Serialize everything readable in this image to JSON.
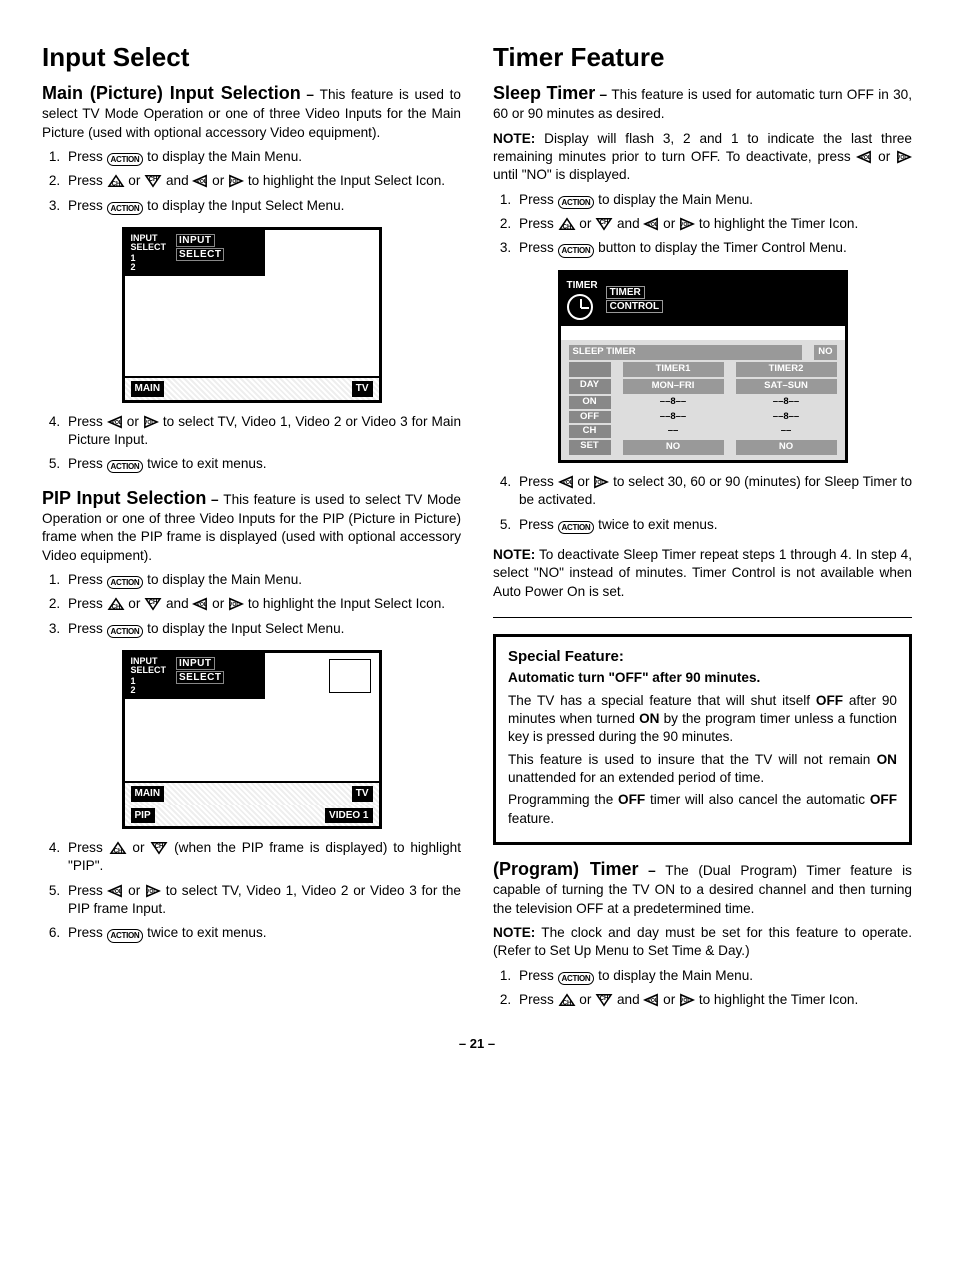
{
  "page_number": "– 21 –",
  "icons": {
    "action": "ACTION"
  },
  "left": {
    "h1": "Input Select",
    "main_sel": {
      "title": "Main (Picture) Input Selection",
      "dash": " – ",
      "lead": "This feature is used to select TV Mode Operation or one of three Video Inputs for the Main Picture (used with optional accessory Video equipment).",
      "s1a": "Press ",
      "s1b": " to display the Main Menu.",
      "s2a": "Press ",
      "s2b": " or ",
      "s2c": " and ",
      "s2d": " or ",
      "s2e": " to highlight the Input Select Icon.",
      "s3a": "Press ",
      "s3b": " to display the Input Select Menu.",
      "s4a": "Press ",
      "s4b": " or ",
      "s4c": " to select TV, Video 1, Video 2 or Video 3 for Main Picture Input.",
      "s5a": "Press ",
      "s5b": " twice to exit menus."
    },
    "osd1": {
      "label1": "INPUT",
      "label2": "SELECT",
      "box1": "INPUT",
      "box2": "SELECT",
      "row1": "1",
      "row2": "2",
      "bot_l": "MAIN",
      "bot_r": "TV"
    },
    "pip_sel": {
      "title": "PIP Input Selection",
      "dash": " – ",
      "lead": "This feature is used to select TV Mode Operation or one of three Video Inputs for the PIP (Picture in Picture) frame when the PIP frame is displayed (used with optional accessory Video equipment).",
      "s1a": "Press ",
      "s1b": " to display the Main Menu.",
      "s2a": "Press ",
      "s2b": " or ",
      "s2c": " and ",
      "s2d": " or ",
      "s2e": " to highlight the Input Select Icon.",
      "s3a": "Press ",
      "s3b": " to display the Input Select Menu.",
      "s4a": "Press ",
      "s4b": " or ",
      "s4c": " (when the PIP frame is displayed) to highlight \"PIP\".",
      "s5a": "Press ",
      "s5b": " or ",
      "s5c": " to select TV, Video 1, Video 2 or Video 3 for the PIP frame Input.",
      "s6a": "Press ",
      "s6b": " twice to exit menus."
    },
    "osd2": {
      "bot2_l": "PIP",
      "bot2_r": "VIDEO 1"
    }
  },
  "right": {
    "h1": "Timer Feature",
    "sleep": {
      "title": "Sleep Timer",
      "dash": " – ",
      "lead": "This feature is used for automatic turn OFF in 30, 60 or 90 minutes as desired.",
      "note_b": "NOTE:",
      "note_a": " Display will flash 3, 2 and 1 to indicate the last three remaining minutes prior to turn OFF. To deactivate, press ",
      "note_c": " or ",
      "note_d": " until \"NO\" is displayed.",
      "s1a": "Press ",
      "s1b": " to display the Main Menu.",
      "s2a": "Press ",
      "s2b": " or ",
      "s2c": " and ",
      "s2d": " or ",
      "s2e": " to highlight the Timer Icon.",
      "s3a": "Press ",
      "s3b": " button to display the Timer Control Menu.",
      "s4a": "Press ",
      "s4b": " or ",
      "s4c": " to select 30, 60 or 90 (minutes) for Sleep Timer to be activated.",
      "s5a": "Press ",
      "s5b": " twice to exit menus.",
      "note2_b": "NOTE:",
      "note2": " To deactivate Sleep Timer repeat steps 1 through 4. In step 4, select \"NO\" instead of minutes. Timer Control is not available when Auto Power On is set."
    },
    "osd": {
      "hdr": "TIMER",
      "hdr2a": "TIMER",
      "hdr2b": "CONTROL",
      "sleep": "SLEEP TIMER",
      "no": "NO",
      "t1": "TIMER1",
      "t2": "TIMER2",
      "day": "DAY",
      "monfri": "MON–FRI",
      "satsun": "SAT–SUN",
      "on": "ON",
      "off": "OFF",
      "ch": "CH",
      "set": "SET",
      "no2": "NO",
      "no3": "NO"
    },
    "special": {
      "h": "Special Feature:",
      "sb": "Automatic turn \"OFF\" after 90 minutes.",
      "p1a": "The TV has a special feature that will shut itself ",
      "p1b": "OFF",
      "p1c": " after 90 minutes when turned ",
      "p1d": "ON",
      "p1e": " by the program timer unless a function key is pressed during the 90 minutes.",
      "p2a": "This feature is used to insure that the TV will not remain ",
      "p2b": "ON",
      "p2c": " unattended for an extended period of time.",
      "p3a": "Programming the ",
      "p3b": "OFF",
      "p3c": " timer will also cancel the automatic ",
      "p3d": "OFF",
      "p3e": " feature."
    },
    "prog": {
      "title": "(Program) Timer",
      "dash": " – ",
      "lead": "The (Dual Program) Timer feature is capable of turning the TV ON to a desired channel and then turning the television OFF at a predetermined time.",
      "note_b": "NOTE:",
      "note": " The clock and day must be set for this feature to operate. (Refer to Set Up Menu to Set Time & Day.)",
      "s1a": "Press ",
      "s1b": " to display the Main Menu.",
      "s2a": "Press ",
      "s2b": " or ",
      "s2c": " and ",
      "s2d": " or ",
      "s2e": " to highlight the Timer Icon."
    }
  }
}
